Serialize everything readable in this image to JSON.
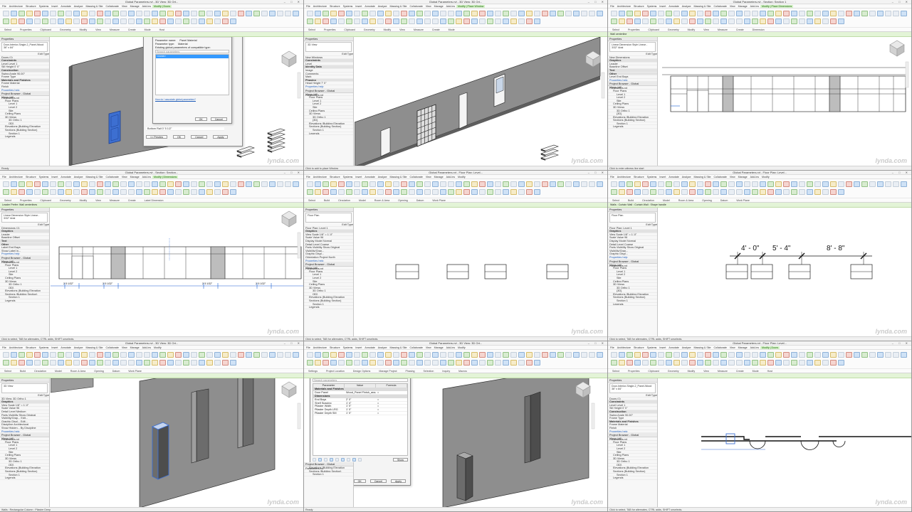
{
  "frames": [
    {
      "title": "Global Parameters.rvt - 3D View: 3D Ort...",
      "menus": [
        "File",
        "Architecture",
        "Structure",
        "Systems",
        "Insert",
        "Annotate",
        "Analyze",
        "Massing & Site",
        "Collaborate",
        "View",
        "Manage",
        "Add-Ins",
        "Modify | Doors"
      ],
      "ribbon_groups": [
        "Select",
        "Properties",
        "Clipboard",
        "Geometry",
        "Modify",
        "View",
        "Measure",
        "Create",
        "Mode",
        "Host"
      ],
      "properties_header": "Properties",
      "type_name": "Door-Interior-Single-2_Panel-Wood 36\" x 84\"",
      "prop_rows": [
        "Doors (1)",
        "Constraints",
        "Level   Level 1",
        "Sill Height   0' 0\"",
        "Construction",
        "Swing Angle   90.00°",
        "Frame Type",
        "Materials and Finishes",
        "Frame Material",
        "Finish"
      ],
      "browser_header": "Project Browser - Global Parameters.rvt",
      "browser_rows": [
        "Views (all)",
        "Floor Plans",
        "Level 1",
        "Level 2",
        "Site",
        "Ceiling Plans",
        "3D Views",
        "3D Ortho 1",
        "{3D}",
        "Elevations (Building Elevation",
        "Sections (Building Section)",
        "Section 1",
        "Legends"
      ],
      "status": "Ready",
      "dialog_back": {
        "title": "Type Properties",
        "family_label": "Family:",
        "family_value": "Door-Interior-Single-2_Panel-Wood",
        "type_label": "Type:",
        "type_value": "36\" x 84\"",
        "load": "Load...",
        "bottom_row": "Bottom Rail   0' 5 1/2\"",
        "buttons": [
          "<< Preview",
          "OK",
          "Cancel",
          "Apply"
        ]
      },
      "dialog_front": {
        "title": "Associate Global Parameter",
        "param_name_label": "Parameter name:",
        "param_name": "Panel Material",
        "param_type_label": "Parameter type:",
        "param_type": "Material",
        "list_label": "Existing global parameters of compatible type:",
        "search_placeholder": "Search parameters",
        "selected": "<none>",
        "link_text": "How do I associate global parameters?",
        "buttons": [
          "OK",
          "Cancel"
        ]
      }
    },
    {
      "title": "Global Parameters.rvt - 3D View: 3D Ort...",
      "menus": [
        "File",
        "Architecture",
        "Structure",
        "Systems",
        "Insert",
        "Annotate",
        "Analyze",
        "Massing & Site",
        "Collaborate",
        "View",
        "Manage",
        "Add-Ins",
        "Modify | Place Window"
      ],
      "ribbon_groups": [
        "Select",
        "Properties",
        "Clipboard",
        "Geometry",
        "Modify",
        "View",
        "Measure",
        "Create",
        "Mode"
      ],
      "type_name": "3D View",
      "prop_rows": [
        "New Windows",
        "Constraints",
        "Level",
        "Identity Data",
        "Image",
        "Comments",
        "Mark",
        "Phasing",
        "Head Height   7' 0\""
      ],
      "browser_rows": [
        "Views (all)",
        "Floor Plans",
        "Level 1",
        "Level 2",
        "Site",
        "Ceiling Plans",
        "3D Views",
        "3D Ortho 1",
        "{3D}",
        "Elevations (Building Elevation",
        "Sections (Building Section)",
        "Section 1",
        "Legends"
      ],
      "status": "Click to add to place Window"
    },
    {
      "title": "Global Parameters.rvt - Section: Section 1",
      "menus": [
        "File",
        "Architecture",
        "Structure",
        "Systems",
        "Insert",
        "Annotate",
        "Analyze",
        "Massing & Site",
        "Collaborate",
        "View",
        "Manage",
        "Add-Ins",
        "Modify | Place Dimensions"
      ],
      "ribbon_groups": [
        "Select",
        "Properties",
        "Clipboard",
        "Geometry",
        "Modify",
        "View",
        "Measure",
        "Create",
        "Dimension"
      ],
      "greenbar": "Wall centerline",
      "type_name": "Linear Dimension Style Linear - 3/32\" Arial",
      "prop_rows": [
        "New Dimensions",
        "Graphics",
        "Leader",
        "Baseline Offset",
        "Text",
        "Other",
        "Level   End Bays"
      ],
      "browser_rows": [
        "Views (all)",
        "Floor Plans",
        "Level 1",
        "Level 2",
        "Site",
        "Ceiling Plans",
        "3D Views",
        "3D Ortho 1",
        "{3D}",
        "Elevations (Building Elevation",
        "Sections (Building Section)",
        "Section 1",
        "Legends"
      ],
      "status": "Click to enter witness line start"
    },
    {
      "title": "Global Parameters.rvt - Section: Section...",
      "menus": [
        "File",
        "Architecture",
        "Structure",
        "Systems",
        "Insert",
        "Annotate",
        "Analyze",
        "Massing & Site",
        "Collaborate",
        "View",
        "Manage",
        "Add-Ins",
        "Modify | Dimensions"
      ],
      "ribbon_groups": [
        "Select",
        "Properties",
        "Clipboard",
        "Geometry",
        "Modify",
        "View",
        "Measure",
        "Create",
        "Label Dimension"
      ],
      "label_value": "End Bays",
      "greenbar": "Leader   Prefer:  Wall centerlines",
      "type_name": "Linear Dimension Style Linear - 3/32\" Arial",
      "prop_rows": [
        "Dimensions (1)",
        "Graphics",
        "Leader",
        "Baseline Offset",
        "Text",
        "Other",
        "Label   End Bays",
        "Show Label in..."
      ],
      "browser_rows": [
        "Views (all)",
        "Floor Plans",
        "Level 1",
        "Level 2",
        "Site",
        "Ceiling Plans",
        "3D Views",
        "3D Ortho 1",
        "{3D}",
        "Elevations (Building Elevation",
        "Sections (Building Section)",
        "Section 1",
        "Legends"
      ],
      "dim_label": "2' 5 1/32\"",
      "status": "Click to select, TAB for alternates, CTRL adds, SHIFT unselects."
    },
    {
      "title": "Global Parameters.rvt - Floor Plan: Level...",
      "menus": [
        "File",
        "Architecture",
        "Structure",
        "Systems",
        "Insert",
        "Annotate",
        "Analyze",
        "Massing & Site",
        "Collaborate",
        "View",
        "Manage",
        "Add-Ins",
        "Modify"
      ],
      "ribbon_groups": [
        "Select",
        "Build",
        "Circulation",
        "Model",
        "Room & Area",
        "Opening",
        "Datum",
        "Work Plane"
      ],
      "type_name": "Floor Plan",
      "prop_rows": [
        "Floor Plan: Level 1",
        "Graphics",
        "View Scale   1/8\" = 1'-0\"",
        "Scale Value   96",
        "Display Model   Normal",
        "Detail Level   Coarse",
        "Parts Visibility   Show Original",
        "Visibility/Grap...",
        "Graphic Displ...",
        "Orientation   Project North"
      ],
      "browser_rows": [
        "Views (all)",
        "Floor Plans",
        "Level 1",
        "Level 2",
        "Site",
        "Ceiling Plans",
        "3D Views",
        "3D Ortho 1",
        "{3D}",
        "Elevations (Building Elevation",
        "Sections (Building Section)",
        "Section 1",
        "Legends"
      ],
      "status": "Click to select, TAB for alternates, CTRL adds, SHIFT unselects."
    },
    {
      "title": "Global Parameters.rvt - Floor Plan: Level...",
      "menus": [
        "File",
        "Architecture",
        "Structure",
        "Systems",
        "Insert",
        "Annotate",
        "Analyze",
        "Massing & Site",
        "Collaborate",
        "View",
        "Manage",
        "Add-Ins",
        "Modify"
      ],
      "ribbon_groups": [
        "Select",
        "Build",
        "Circulation",
        "Model",
        "Room & Area",
        "Opening",
        "Datum",
        "Work Plane"
      ],
      "greenbar": "Walls : Curtain Wall : Curtain Wall : Shape handle",
      "type_name": "Floor Plan",
      "prop_rows": [
        "Floor Plan: Level 1",
        "Graphics",
        "View Scale   1/8\" = 1'-0\"",
        "Scale Value   96",
        "Display Model   Normal",
        "Detail Level   Coarse",
        "Parts Visibility   Show Original",
        "Visibility/Grap...",
        "Graphic Displ..."
      ],
      "browser_rows": [
        "Views (all)",
        "Floor Plans",
        "Level 1",
        "Level 2",
        "Site",
        "Ceiling Plans",
        "3D Views",
        "3D Ortho 1",
        "{3D}",
        "Elevations (Building Elevation",
        "Sections (Building Section)",
        "Section 1",
        "Legends"
      ],
      "dims": [
        "4' - 0\"",
        "5' - 4\"",
        "8' - 8\""
      ],
      "status": "Click to select, TAB for alternates, CTRL adds, SHIFT unselects."
    },
    {
      "title": "Global Parameters.rvt - 3D View: 3D Ort...",
      "menus": [
        "File",
        "Architecture",
        "Structure",
        "Systems",
        "Insert",
        "Annotate",
        "Analyze",
        "Massing & Site",
        "Collaborate",
        "View",
        "Manage",
        "Add-Ins",
        "Modify"
      ],
      "ribbon_groups": [
        "Select",
        "Build",
        "Circulation",
        "Model",
        "Room & Area",
        "Opening",
        "Datum",
        "Work Plane"
      ],
      "type_name": "3D View",
      "prop_rows": [
        "3D View: 3D Ortho 1",
        "Graphics",
        "View Scale   1/8\" = 1'-0\"",
        "Scale Value   96",
        "Detail Level   Medium",
        "Parts Visibility   Show Original",
        "Visibility/Grap...   Edit...",
        "Graphic Displ...   Edit...",
        "Discipline   Architectural",
        "Show Hidden...   By Discipline"
      ],
      "browser_rows": [
        "Views (all)",
        "Floor Plans",
        "Level 1",
        "Level 2",
        "Site",
        "Ceiling Plans",
        "3D Views",
        "3D Ortho 1",
        "{3D}",
        "Elevations (Building Elevation",
        "Sections (Building Section)",
        "Section 1",
        "Legends"
      ],
      "status": "Walls : Rectangular Column : Pilaster Deep"
    },
    {
      "title": "Global Parameters.rvt - 3D View: 3D Ort...",
      "menus": [
        "File",
        "Architecture",
        "Structure",
        "Systems",
        "Insert",
        "Annotate",
        "Analyze",
        "Massing & Site",
        "Collaborate",
        "View",
        "Manage",
        "Add-Ins",
        "Modify"
      ],
      "ribbon_groups": [
        "Settings",
        "Project Location",
        "Design Options",
        "Manage Project",
        "Phasing",
        "Selection",
        "Inquiry",
        "Macros"
      ],
      "dialog": {
        "title": "Global Parameters",
        "search_placeholder": "Search parameters",
        "columns": [
          "Parameter",
          "Value",
          "Formula"
        ],
        "groups": [
          "Materials and Finishes",
          "Dimensions"
        ],
        "rows": [
          {
            "name": "Door Panel",
            "value": "Wood_Panel Finish_ana...",
            "formula": "="
          },
          {
            "name": "End Bays",
            "value": "2' 0\"",
            "formula": "="
          },
          {
            "name": "Shelf Spacing",
            "value": "1' 4\"",
            "formula": "="
          },
          {
            "name": "Pilaster Width",
            "value": "1' 0\"",
            "formula": "="
          },
          {
            "name": "Pilaster Depth LRG",
            "value": "1' 0\"",
            "formula": "="
          },
          {
            "name": "Pilaster Depth SM",
            "value": "1' 0\"",
            "formula": "="
          }
        ],
        "link_text": "How do I manage global parameters?",
        "show": "Show",
        "buttons": [
          "OK",
          "Cancel",
          "Apply"
        ]
      },
      "browser_rows": [
        "Elevations (Building Elevation",
        "Sections (Building Section)",
        "Section 1"
      ],
      "status": "Ready"
    },
    {
      "title": "Global Parameters.rvt - Floor Plan: Level...",
      "menus": [
        "File",
        "Architecture",
        "Structure",
        "Systems",
        "Insert",
        "Annotate",
        "Analyze",
        "Massing & Site",
        "Collaborate",
        "View",
        "Manage",
        "Add-Ins",
        "Modify | Doors"
      ],
      "ribbon_groups": [
        "Select",
        "Properties",
        "Clipboard",
        "Geometry",
        "Modify",
        "View",
        "Measure",
        "Create",
        "Mode",
        "Host"
      ],
      "type_name": "Door-Interior-Single-2_Panel-Wood 36\" x 84\"",
      "prop_rows": [
        "Doors (1)",
        "Constraints",
        "Level   Level 1",
        "Sill Height   0' 0\"",
        "Construction",
        "Swing Angle   90.00°",
        "Frame Type",
        "Materials and Finishes",
        "Frame Material",
        "Finish"
      ],
      "browser_rows": [
        "Views (all)",
        "Floor Plans",
        "Level 1",
        "Level 2",
        "Site",
        "Ceiling Plans",
        "3D Views",
        "3D Ortho 1",
        "{3D}",
        "Elevations (Building Elevation",
        "Sections (Building Section)",
        "Section 1",
        "Legends"
      ],
      "status": "Click to select, TAB for alternates, CTRL adds, SHIFT unselects."
    }
  ],
  "common": {
    "properties_header": "Properties",
    "browser_header": "Project Browser - Global Parameters.rvt",
    "edit_type": "Edit Type",
    "properties_help": "Properties help",
    "apply": "Apply",
    "watermark": "lynda.com",
    "search_hint": "Type a keyword or phrase",
    "sign_in": "Sign In"
  },
  "colors": {
    "wall": "#8a8a8a",
    "wall_dark": "#5a5a5a",
    "wall_top": "#b5b5b5",
    "selected": "#3d6fd1",
    "context_tab": "#d6f5c8",
    "plan_line": "#333333"
  }
}
